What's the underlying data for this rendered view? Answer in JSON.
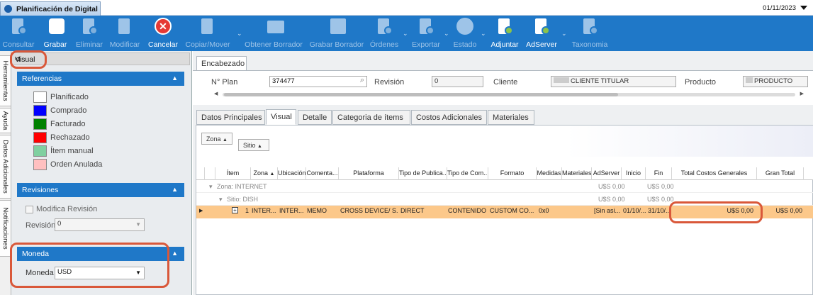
{
  "window": {
    "tab_title": "Planificación de Digital",
    "date": "01/11/2023"
  },
  "toolbar": {
    "buttons": [
      {
        "label": "Consultar",
        "enabled": false
      },
      {
        "label": "Grabar",
        "enabled": true
      },
      {
        "label": "Eliminar",
        "enabled": false
      },
      {
        "label": "Modificar",
        "enabled": false
      },
      {
        "label": "Cancelar",
        "enabled": true
      },
      {
        "label": "Copiar/Mover",
        "enabled": false
      },
      {
        "label": "Obtener Borrador",
        "enabled": false
      },
      {
        "label": "Grabar Borrador",
        "enabled": false
      },
      {
        "label": "Órdenes",
        "enabled": false
      },
      {
        "label": "Exportar",
        "enabled": false
      },
      {
        "label": "Estado",
        "enabled": false
      },
      {
        "label": "Adjuntar",
        "enabled": true
      },
      {
        "label": "AdServer",
        "enabled": true
      },
      {
        "label": "Taxonomia",
        "enabled": false
      }
    ],
    "accent": "#1f78c8"
  },
  "side_tabs": [
    "Herramientas",
    "Ayuda",
    "Datos Adicionales",
    "Notificaciones"
  ],
  "left_panel": {
    "title": "Visual",
    "referencias": {
      "title": "Referencias",
      "items": [
        {
          "label": "Planificado",
          "color": "#ffffff"
        },
        {
          "label": "Comprado",
          "color": "#0000ff"
        },
        {
          "label": "Facturado",
          "color": "#008000"
        },
        {
          "label": "Rechazado",
          "color": "#ff0000"
        },
        {
          "label": "Ítem manual",
          "color": "#80d0a0"
        },
        {
          "label": "Orden Anulada",
          "color": "#ffc0c0"
        }
      ]
    },
    "revisiones": {
      "title": "Revisiones",
      "modifica_label": "Modifica Revisión",
      "revision_label": "Revisión",
      "revision_value": "0"
    },
    "moneda": {
      "title": "Moneda",
      "label": "Moneda",
      "value": "USD"
    }
  },
  "encabezado": {
    "tab": "Encabezado",
    "nplan_label": "N° Plan",
    "nplan_value": "374477",
    "revision_label": "Revisión",
    "revision_value": "0",
    "cliente_label": "Cliente",
    "cliente_value": "CLIENTE TITULAR",
    "producto_label": "Producto",
    "producto_value": "PRODUCTO"
  },
  "tabs": [
    "Datos Principales",
    "Visual",
    "Detalle",
    "Categoria de ítems",
    "Costos Adicionales",
    "Materiales"
  ],
  "grid": {
    "group_chips": [
      "Zona",
      "Sitio"
    ],
    "columns": [
      "Ítem",
      "Zona",
      "Ubicación",
      "Comenta...",
      "Plataforma",
      "Tipo de Publica...",
      "Tipo de Com...",
      "Formato",
      "Medidas",
      "Materiales",
      "AdServer",
      "Inicio",
      "Fin",
      "Total Costos Generales",
      "Gran Total"
    ],
    "group_zona": "Zona: INTERNET",
    "group_sitio": "Sitio: DISH",
    "group_vals": [
      "U$S 0,00",
      "U$S 0,00"
    ],
    "row": [
      "1",
      "INTER...",
      "INTER...",
      "MEMO",
      "CROSS DEVICE/ S...",
      "DIRECT",
      "CONTENIDO",
      "CUSTOM CO...",
      "0x0",
      "",
      "[Sin asi...",
      "01/10/...",
      "31/10/...",
      "U$S 0,00",
      "U$S 0,00"
    ]
  }
}
